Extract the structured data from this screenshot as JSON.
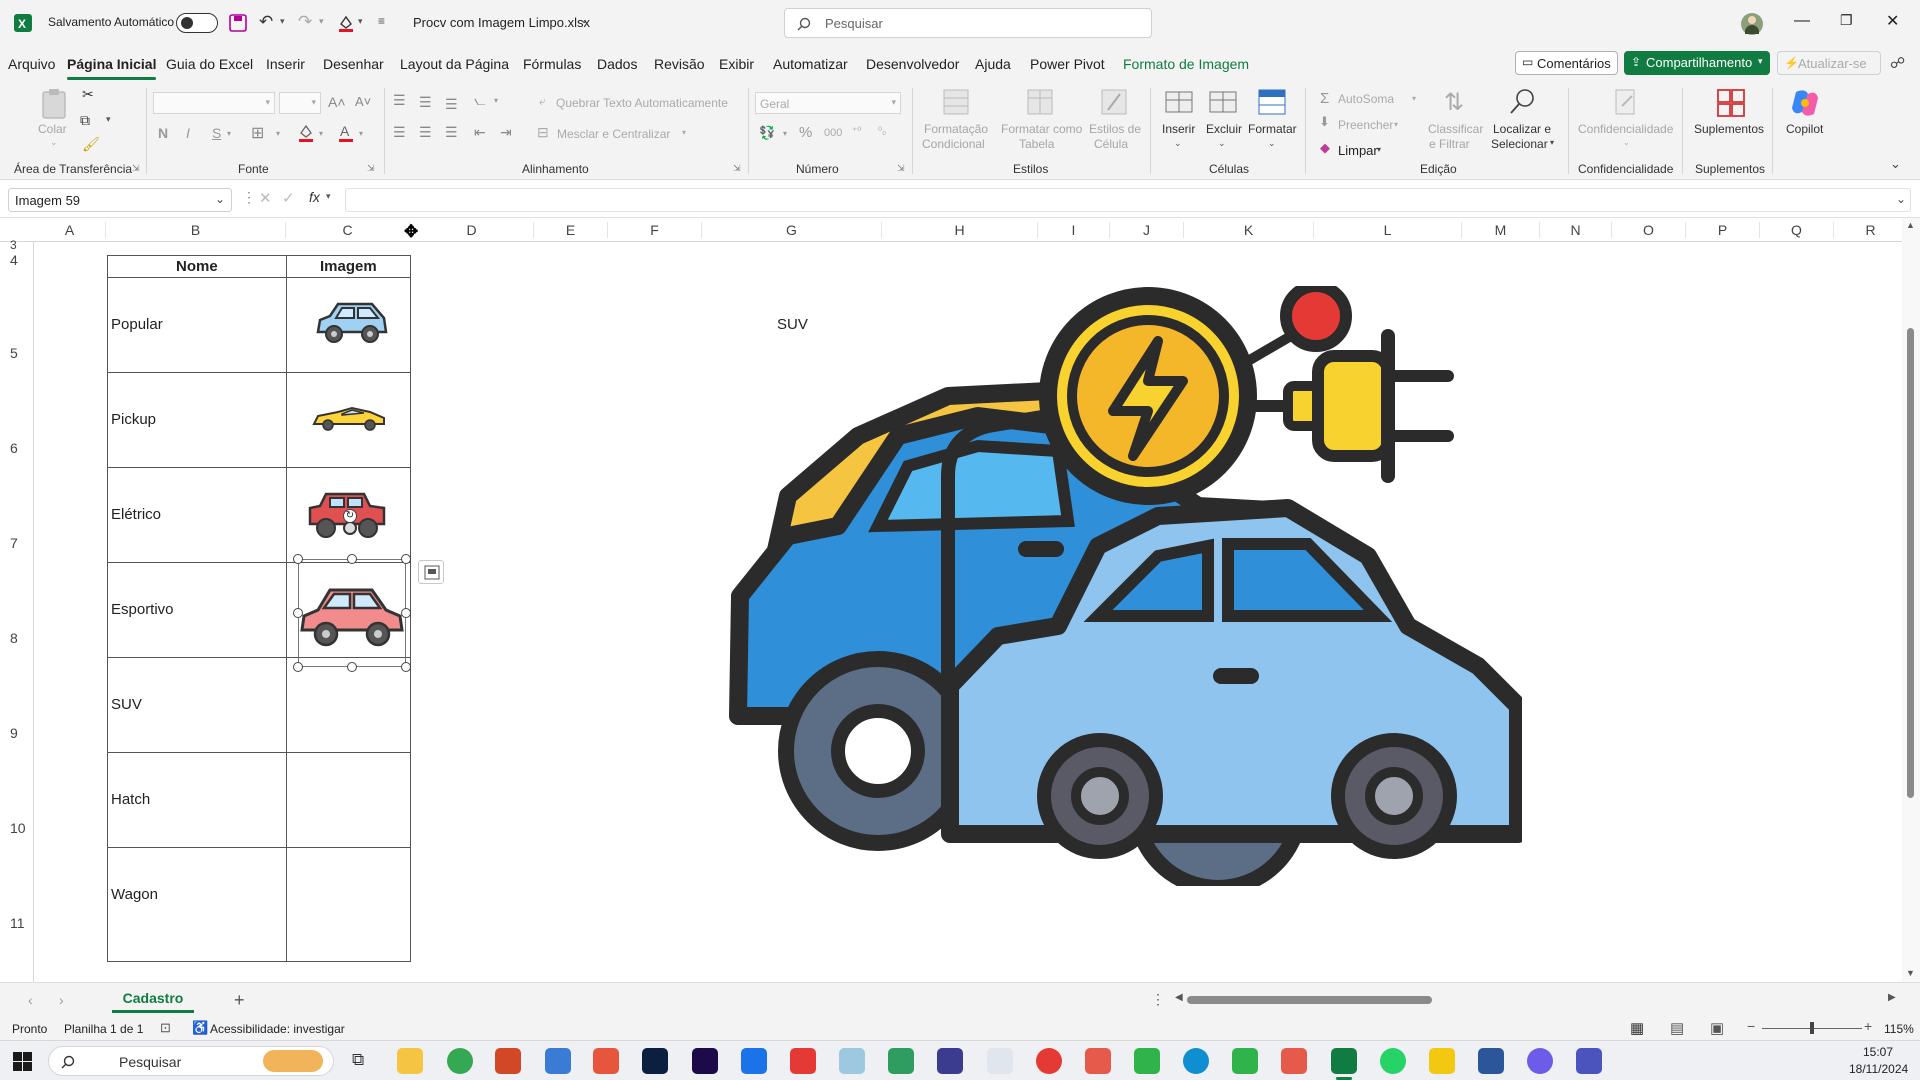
{
  "titlebar": {
    "autosave_label": "Salvamento Automático",
    "filename": "Procv com Imagem Limpo.xlsx",
    "search_placeholder": "Pesquisar"
  },
  "menu": {
    "items": [
      "Arquivo",
      "Página Inicial",
      "Guia do Excel",
      "Inserir",
      "Desenhar",
      "Layout da Página",
      "Fórmulas",
      "Dados",
      "Revisão",
      "Exibir",
      "Automatizar",
      "Desenvolvedor",
      "Ajuda",
      "Power Pivot",
      "Formato de Imagem"
    ],
    "comments": "Comentários",
    "share": "Compartilhamento",
    "update": "Atualizar-se"
  },
  "ribbon": {
    "paste": "Colar",
    "clipboard_group": "Área de Transferência",
    "font_group": "Fonte",
    "wrap_text": "Quebrar Texto Automaticamente",
    "merge_center": "Mesclar e Centralizar",
    "alignment_group": "Alinhamento",
    "number_format": "Geral",
    "number_group": "Número",
    "cond_format_1": "Formatação",
    "cond_format_2": "Condicional",
    "format_table_1": "Formatar como",
    "format_table_2": "Tabela",
    "cell_styles_1": "Estilos de",
    "cell_styles_2": "Célula",
    "styles_group": "Estilos",
    "insert": "Inserir",
    "delete": "Excluir",
    "format": "Formatar",
    "cells_group": "Células",
    "autosum": "AutoSoma",
    "fill": "Preencher",
    "clear": "Limpar",
    "sort_filter_1": "Classificar",
    "sort_filter_2": "e Filtrar",
    "find_select_1": "Localizar e",
    "find_select_2": "Selecionar",
    "editing_group": "Edição",
    "sensitivity": "Confidencialidade",
    "sensitivity_group": "Confidencialidade",
    "addins": "Suplementos",
    "addins_group": "Suplementos",
    "copilot": "Copilot"
  },
  "formula_bar": {
    "name_box": "Imagem 59",
    "fx": "fx",
    "content": ""
  },
  "columns": [
    "A",
    "B",
    "C",
    "D",
    "E",
    "F",
    "G",
    "H",
    "I",
    "J",
    "K",
    "L",
    "M",
    "N",
    "O",
    "P",
    "Q",
    "R"
  ],
  "rows": [
    "3",
    "4",
    "5",
    "6",
    "7",
    "8",
    "9",
    "10",
    "11"
  ],
  "table": {
    "header_name": "Nome",
    "header_image": "Imagem",
    "rows": [
      "Popular",
      "Pickup",
      "Elétrico",
      "Esportivo",
      "SUV",
      "Hatch",
      "Wagon"
    ]
  },
  "lookup_label": "SUV",
  "sheet": {
    "tab": "Cadastro"
  },
  "status": {
    "ready": "Pronto",
    "sheet_count": "Planilha 1 de 1",
    "accessibility": "Acessibilidade: investigar",
    "zoom": "115%"
  },
  "taskbar": {
    "search": "Pesquisar",
    "time": "15:07",
    "date": "18/11/2024"
  },
  "colors": {
    "excel_green": "#107c41",
    "car_blue": "#8ec4ee",
    "car_dark_blue": "#2f8fd8",
    "bolt_yellow": "#f8d22e",
    "car_red": "#f08080"
  }
}
